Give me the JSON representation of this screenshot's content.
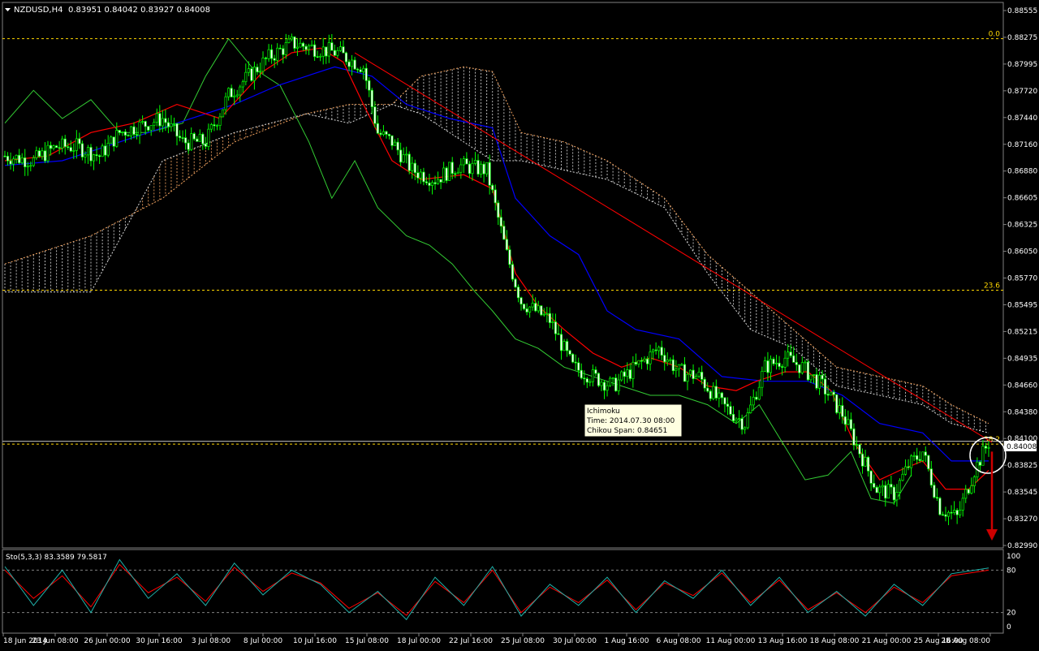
{
  "header": {
    "symbol": "NZDUSD,H4",
    "ohlc": "0.83951 0.84042 0.83927 0.84008"
  },
  "price_axis": {
    "labels": [
      "0.88555",
      "0.88275",
      "0.87995",
      "0.87720",
      "0.87440",
      "0.87160",
      "0.86880",
      "0.86605",
      "0.86325",
      "0.86050",
      "0.85770",
      "0.85495",
      "0.85215",
      "0.84935",
      "0.84660",
      "0.84380",
      "0.84100",
      "0.83825",
      "0.83545",
      "0.83270",
      "0.82990"
    ],
    "current_price": "0.84008"
  },
  "fib_levels": [
    {
      "label": "0.0",
      "price": 0.883
    },
    {
      "label": "23.6",
      "price": 0.8562
    },
    {
      "label": "38.2",
      "price": 0.8398
    }
  ],
  "tooltip": {
    "title": "Ichimoku",
    "time": "Time: 2014.07.30 08:00",
    "value": "Chikou Span: 0.84651"
  },
  "stochastic": {
    "label": "Sto(5,3,3) 83.3589 79.5817",
    "axis_labels": [
      "100",
      "80",
      "20",
      "0"
    ]
  },
  "time_axis": {
    "labels": [
      "18 Jun 2014",
      "23 Jun 08:00",
      "26 Jun 00:00",
      "30 Jun 16:00",
      "3 Jul 08:00",
      "8 Jul 00:00",
      "10 Jul 16:00",
      "15 Jul 08:00",
      "18 Jul 00:00",
      "22 Jul 16:00",
      "25 Jul 08:00",
      "30 Jul 00:00",
      "1 Aug 16:00",
      "6 Aug 08:00",
      "11 Aug 00:00",
      "13 Aug 16:00",
      "18 Aug 08:00",
      "21 Aug 00:00",
      "25 Aug 16:00",
      "28 Aug 08:00"
    ]
  },
  "colors": {
    "background": "#000000",
    "candles": "#00ff00",
    "tenkan": "#ff0000",
    "kijun": "#0000ff",
    "chikou": "#33cc33",
    "cloud_a": "#f4a460",
    "cloud_b": "#d8d8d8",
    "fib": "#ffd700",
    "trendline": "#ff0000",
    "stoch_main": "#20b2aa",
    "stoch_signal": "#ff0000",
    "text": "#ffffff"
  },
  "chart_data": {
    "type": "candlestick",
    "instrument": "NZDUSD",
    "timeframe": "H4",
    "ylim": [
      0.829,
      0.886
    ],
    "close_path": [
      [
        0,
        0.8705
      ],
      [
        10,
        0.87
      ],
      [
        18,
        0.8715
      ],
      [
        25,
        0.8715
      ],
      [
        33,
        0.8705
      ],
      [
        40,
        0.873
      ],
      [
        48,
        0.8738
      ],
      [
        55,
        0.8745
      ],
      [
        62,
        0.872
      ],
      [
        70,
        0.872
      ],
      [
        78,
        0.877
      ],
      [
        85,
        0.879
      ],
      [
        92,
        0.881
      ],
      [
        100,
        0.8825
      ],
      [
        108,
        0.882
      ],
      [
        116,
        0.8815
      ],
      [
        125,
        0.88
      ],
      [
        130,
        0.873
      ],
      [
        135,
        0.872
      ],
      [
        142,
        0.869
      ],
      [
        150,
        0.868
      ],
      [
        158,
        0.8695
      ],
      [
        168,
        0.869
      ],
      [
        175,
        0.86
      ],
      [
        180,
        0.855
      ],
      [
        185,
        0.854
      ],
      [
        190,
        0.853
      ],
      [
        198,
        0.848
      ],
      [
        205,
        0.847
      ],
      [
        212,
        0.846
      ],
      [
        220,
        0.848
      ],
      [
        228,
        0.85
      ],
      [
        235,
        0.8475
      ],
      [
        242,
        0.847
      ],
      [
        250,
        0.844
      ],
      [
        258,
        0.842
      ],
      [
        265,
        0.848
      ],
      [
        272,
        0.849
      ],
      [
        278,
        0.848
      ],
      [
        285,
        0.846
      ],
      [
        292,
        0.843
      ],
      [
        298,
        0.839
      ],
      [
        304,
        0.835
      ],
      [
        310,
        0.8345
      ],
      [
        315,
        0.8375
      ],
      [
        320,
        0.839
      ],
      [
        326,
        0.833
      ],
      [
        332,
        0.832
      ],
      [
        338,
        0.837
      ],
      [
        343,
        0.84
      ]
    ],
    "tenkan_path": [
      [
        0,
        0.87
      ],
      [
        15,
        0.8705
      ],
      [
        30,
        0.873
      ],
      [
        45,
        0.874
      ],
      [
        60,
        0.876
      ],
      [
        75,
        0.8745
      ],
      [
        90,
        0.8795
      ],
      [
        100,
        0.8815
      ],
      [
        110,
        0.882
      ],
      [
        118,
        0.8805
      ],
      [
        125,
        0.876
      ],
      [
        135,
        0.87
      ],
      [
        145,
        0.868
      ],
      [
        160,
        0.8685
      ],
      [
        170,
        0.867
      ],
      [
        178,
        0.858
      ],
      [
        186,
        0.8545
      ],
      [
        195,
        0.852
      ],
      [
        205,
        0.8495
      ],
      [
        215,
        0.848
      ],
      [
        225,
        0.849
      ],
      [
        235,
        0.848
      ],
      [
        245,
        0.846
      ],
      [
        255,
        0.8455
      ],
      [
        262,
        0.8465
      ],
      [
        272,
        0.8475
      ],
      [
        280,
        0.8475
      ],
      [
        288,
        0.8455
      ],
      [
        296,
        0.84
      ],
      [
        305,
        0.836
      ],
      [
        312,
        0.837
      ],
      [
        320,
        0.838
      ],
      [
        328,
        0.835
      ],
      [
        336,
        0.835
      ],
      [
        343,
        0.837
      ]
    ],
    "kijun_path": [
      [
        0,
        0.8695
      ],
      [
        20,
        0.87
      ],
      [
        40,
        0.872
      ],
      [
        60,
        0.874
      ],
      [
        80,
        0.876
      ],
      [
        95,
        0.878
      ],
      [
        115,
        0.88
      ],
      [
        128,
        0.879
      ],
      [
        140,
        0.876
      ],
      [
        155,
        0.8745
      ],
      [
        170,
        0.8735
      ],
      [
        178,
        0.866
      ],
      [
        190,
        0.862
      ],
      [
        200,
        0.86
      ],
      [
        210,
        0.854
      ],
      [
        220,
        0.852
      ],
      [
        235,
        0.851
      ],
      [
        250,
        0.847
      ],
      [
        265,
        0.8465
      ],
      [
        280,
        0.8465
      ],
      [
        292,
        0.845
      ],
      [
        305,
        0.842
      ],
      [
        320,
        0.841
      ],
      [
        330,
        0.838
      ],
      [
        343,
        0.838
      ]
    ],
    "chikou_path": [
      [
        0,
        0.874
      ],
      [
        10,
        0.8775
      ],
      [
        20,
        0.8745
      ],
      [
        30,
        0.8765
      ],
      [
        40,
        0.873
      ],
      [
        50,
        0.873
      ],
      [
        62,
        0.874
      ],
      [
        70,
        0.879
      ],
      [
        78,
        0.883
      ],
      [
        86,
        0.88
      ],
      [
        96,
        0.878
      ],
      [
        106,
        0.872
      ],
      [
        114,
        0.866
      ],
      [
        122,
        0.87
      ],
      [
        130,
        0.865
      ],
      [
        140,
        0.862
      ],
      [
        148,
        0.861
      ],
      [
        156,
        0.859
      ],
      [
        164,
        0.856
      ],
      [
        170,
        0.854
      ],
      [
        178,
        0.851
      ],
      [
        186,
        0.85
      ],
      [
        195,
        0.848
      ],
      [
        205,
        0.847
      ],
      [
        215,
        0.846
      ],
      [
        225,
        0.845
      ],
      [
        235,
        0.845
      ],
      [
        245,
        0.844
      ],
      [
        255,
        0.842
      ],
      [
        263,
        0.844
      ],
      [
        271,
        0.84
      ],
      [
        279,
        0.836
      ],
      [
        287,
        0.8365
      ],
      [
        295,
        0.839
      ],
      [
        302,
        0.834
      ],
      [
        310,
        0.8335
      ],
      [
        316,
        0.8365
      ]
    ],
    "senkou_a_path": [
      [
        0,
        0.859
      ],
      [
        30,
        0.862
      ],
      [
        55,
        0.866
      ],
      [
        80,
        0.872
      ],
      [
        105,
        0.875
      ],
      [
        120,
        0.876
      ],
      [
        135,
        0.876
      ],
      [
        145,
        0.879
      ],
      [
        160,
        0.88
      ],
      [
        170,
        0.8795
      ],
      [
        180,
        0.873
      ],
      [
        195,
        0.872
      ],
      [
        210,
        0.87
      ],
      [
        230,
        0.866
      ],
      [
        245,
        0.86
      ],
      [
        260,
        0.856
      ],
      [
        275,
        0.852
      ],
      [
        290,
        0.848
      ],
      [
        305,
        0.847
      ],
      [
        320,
        0.846
      ],
      [
        330,
        0.844
      ],
      [
        343,
        0.842
      ]
    ],
    "senkou_b_path": [
      [
        0,
        0.856
      ],
      [
        30,
        0.856
      ],
      [
        55,
        0.87
      ],
      [
        80,
        0.873
      ],
      [
        105,
        0.875
      ],
      [
        120,
        0.874
      ],
      [
        135,
        0.876
      ],
      [
        145,
        0.875
      ],
      [
        160,
        0.872
      ],
      [
        170,
        0.87
      ],
      [
        180,
        0.87
      ],
      [
        195,
        0.869
      ],
      [
        210,
        0.868
      ],
      [
        230,
        0.865
      ],
      [
        245,
        0.858
      ],
      [
        260,
        0.852
      ],
      [
        275,
        0.85
      ],
      [
        290,
        0.846
      ],
      [
        305,
        0.845
      ],
      [
        320,
        0.844
      ],
      [
        330,
        0.842
      ],
      [
        343,
        0.841
      ]
    ],
    "trendline": [
      [
        122,
        0.8815
      ],
      [
        343,
        0.84
      ]
    ],
    "target_arrow": [
      [
        343,
        0.839
      ],
      [
        343,
        0.83
      ]
    ],
    "stochastic": {
      "ylim": [
        0,
        100
      ],
      "levels": [
        20,
        80
      ],
      "main_path": [
        [
          0,
          85
        ],
        [
          10,
          30
        ],
        [
          20,
          80
        ],
        [
          30,
          20
        ],
        [
          40,
          95
        ],
        [
          50,
          40
        ],
        [
          60,
          75
        ],
        [
          70,
          30
        ],
        [
          80,
          90
        ],
        [
          90,
          45
        ],
        [
          100,
          80
        ],
        [
          110,
          60
        ],
        [
          120,
          20
        ],
        [
          130,
          50
        ],
        [
          140,
          10
        ],
        [
          150,
          70
        ],
        [
          160,
          30
        ],
        [
          170,
          85
        ],
        [
          180,
          15
        ],
        [
          190,
          60
        ],
        [
          200,
          30
        ],
        [
          210,
          70
        ],
        [
          220,
          20
        ],
        [
          230,
          65
        ],
        [
          240,
          40
        ],
        [
          250,
          80
        ],
        [
          260,
          30
        ],
        [
          270,
          70
        ],
        [
          280,
          20
        ],
        [
          290,
          50
        ],
        [
          300,
          15
        ],
        [
          310,
          60
        ],
        [
          320,
          30
        ],
        [
          330,
          75
        ],
        [
          343,
          83
        ]
      ],
      "signal_path": [
        [
          0,
          80
        ],
        [
          10,
          40
        ],
        [
          20,
          72
        ],
        [
          30,
          28
        ],
        [
          40,
          88
        ],
        [
          50,
          48
        ],
        [
          60,
          70
        ],
        [
          70,
          36
        ],
        [
          80,
          84
        ],
        [
          90,
          50
        ],
        [
          100,
          76
        ],
        [
          110,
          62
        ],
        [
          120,
          26
        ],
        [
          130,
          48
        ],
        [
          140,
          16
        ],
        [
          150,
          64
        ],
        [
          160,
          34
        ],
        [
          170,
          80
        ],
        [
          180,
          20
        ],
        [
          190,
          56
        ],
        [
          200,
          34
        ],
        [
          210,
          66
        ],
        [
          220,
          24
        ],
        [
          230,
          62
        ],
        [
          240,
          44
        ],
        [
          250,
          76
        ],
        [
          260,
          34
        ],
        [
          270,
          66
        ],
        [
          280,
          24
        ],
        [
          290,
          48
        ],
        [
          300,
          20
        ],
        [
          310,
          56
        ],
        [
          320,
          34
        ],
        [
          330,
          72
        ],
        [
          343,
          80
        ]
      ]
    }
  }
}
